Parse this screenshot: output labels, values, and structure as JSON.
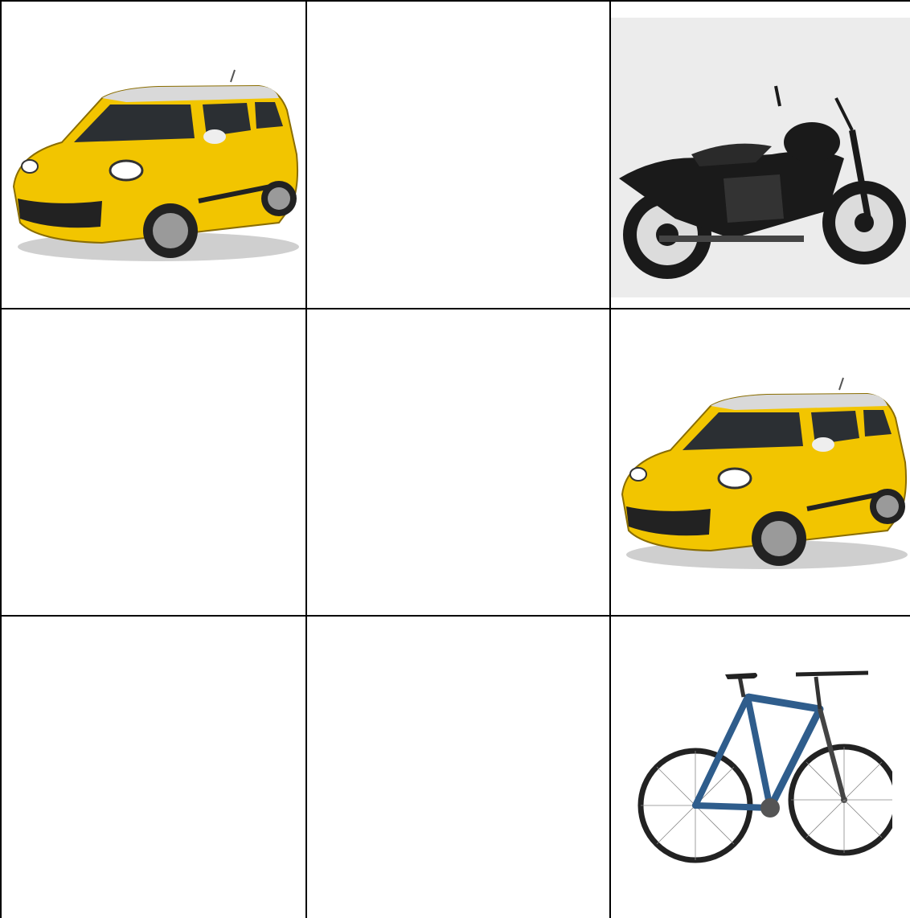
{
  "grid": {
    "rows": 3,
    "columns": 3,
    "line_color": "#000000",
    "background": "#ffffff"
  },
  "cells": [
    {
      "row": 1,
      "col": 1,
      "content": "car-image"
    },
    {
      "row": 1,
      "col": 2,
      "content": "empty"
    },
    {
      "row": 1,
      "col": 3,
      "content": "motorcycle-image"
    },
    {
      "row": 2,
      "col": 1,
      "content": "empty"
    },
    {
      "row": 2,
      "col": 2,
      "content": "empty"
    },
    {
      "row": 2,
      "col": 3,
      "content": "car-image"
    },
    {
      "row": 3,
      "col": 1,
      "content": "empty"
    },
    {
      "row": 3,
      "col": 2,
      "content": "empty"
    },
    {
      "row": 3,
      "col": 3,
      "content": "bicycle-image"
    }
  ],
  "colors": {
    "car_body": "#f2c500",
    "car_roof": "#d9d9d9",
    "motorcycle_body": "#1a1a1a",
    "motorcycle_backdrop": "#ececec",
    "bicycle_frame": "#2f5d8c"
  }
}
